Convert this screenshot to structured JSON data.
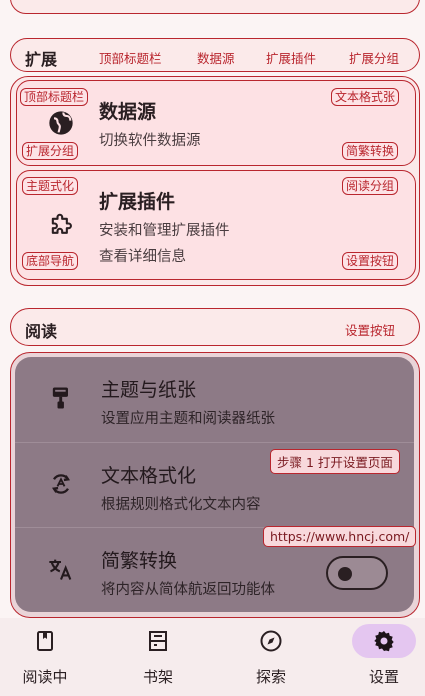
{
  "extension_section": {
    "title": "扩展",
    "tabs": [
      "顶部标题栏",
      "数据源",
      "扩展插件",
      "扩展分组"
    ]
  },
  "cards": [
    {
      "title": "数据源",
      "subtitle": "切换软件数据源",
      "icon": "globe-icon",
      "tags": [
        "顶部标题栏",
        "文本格式张",
        "扩展分组",
        "简繁转换"
      ]
    },
    {
      "title": "扩展插件",
      "subtitle": "安装和管理扩展插件",
      "subtitle2": "查看详细信息",
      "icon": "puzzle-icon",
      "tags": [
        "主题式化",
        "阅读分组",
        "底部导航",
        "设置按钮"
      ]
    }
  ],
  "reading_section": {
    "title": "阅读",
    "action": "设置按钮"
  },
  "settings_rows": [
    {
      "title": "主题与纸张",
      "subtitle": "设置应用主题和阅读器纸张",
      "icon": "paint-roller-icon"
    },
    {
      "title": "文本格式化",
      "subtitle": "根据规则格式化文本内容",
      "icon": "sync-text-icon"
    },
    {
      "title": "简繁转换",
      "subtitle": "将内容从简体航返回功能体",
      "icon": "translate-icon",
      "toggle": false
    }
  ],
  "tooltips": {
    "step": "步骤 1 打开设置页面",
    "url": "https://www.hncj.com/"
  },
  "bottom_nav": [
    {
      "label": "阅读中",
      "icon": "book-icon",
      "active": false
    },
    {
      "label": "书架",
      "icon": "bookshelf-icon",
      "active": false
    },
    {
      "label": "探索",
      "icon": "compass-icon",
      "active": false
    },
    {
      "label": "设置",
      "icon": "gear-icon",
      "active": true
    }
  ],
  "colors": {
    "accent": "#b9262e",
    "panel": "#8d7a86",
    "active_nav": "#e4c6f0"
  }
}
